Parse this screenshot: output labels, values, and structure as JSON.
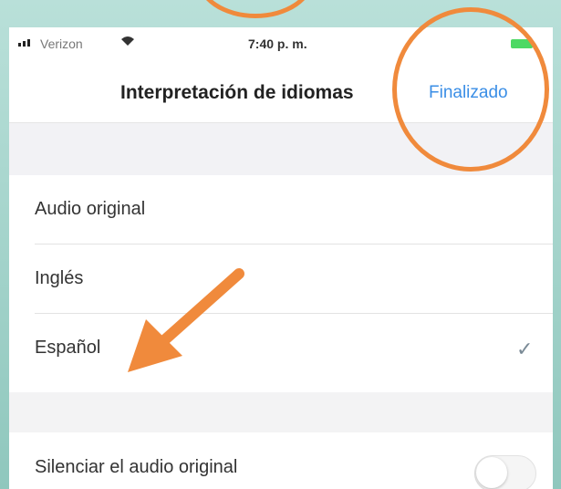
{
  "status_bar": {
    "carrier": "Verizon",
    "time": "7:40 p. m."
  },
  "nav": {
    "title": "Interpretación de idiomas",
    "done_label": "Finalizado"
  },
  "language_options": [
    {
      "label": "Audio original",
      "selected": false
    },
    {
      "label": "Inglés",
      "selected": false
    },
    {
      "label": "Español",
      "selected": true
    }
  ],
  "mute_original": {
    "label": "Silenciar el audio original",
    "enabled": false
  },
  "annotations": {
    "highlight_color": "#f08a3c",
    "accent_color": "#3a8ee6"
  }
}
